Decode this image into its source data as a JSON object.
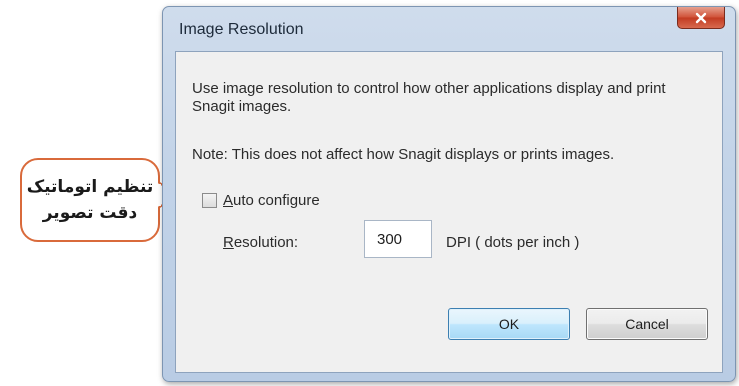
{
  "callout": {
    "line1": "تنظیم اتوماتیک",
    "line2": "دقت تصویر"
  },
  "dialog": {
    "title": "Image Resolution",
    "close_icon": "close-x-icon",
    "description": "Use image resolution to control how other applications display and print Snagit images.",
    "note": "Note: This does not affect how Snagit displays or prints images.",
    "auto_configure": {
      "mnemonic": "A",
      "rest": "uto configure",
      "checked": false
    },
    "resolution": {
      "label_mnemonic": "R",
      "label_rest": "esolution:",
      "value": "300",
      "unit": "DPI ( dots per inch )"
    },
    "buttons": {
      "ok": "OK",
      "cancel": "Cancel"
    }
  },
  "colors": {
    "callout_border": "#d96a3b",
    "close_button": "#c23b22",
    "ok_border": "#3c7fb1"
  }
}
